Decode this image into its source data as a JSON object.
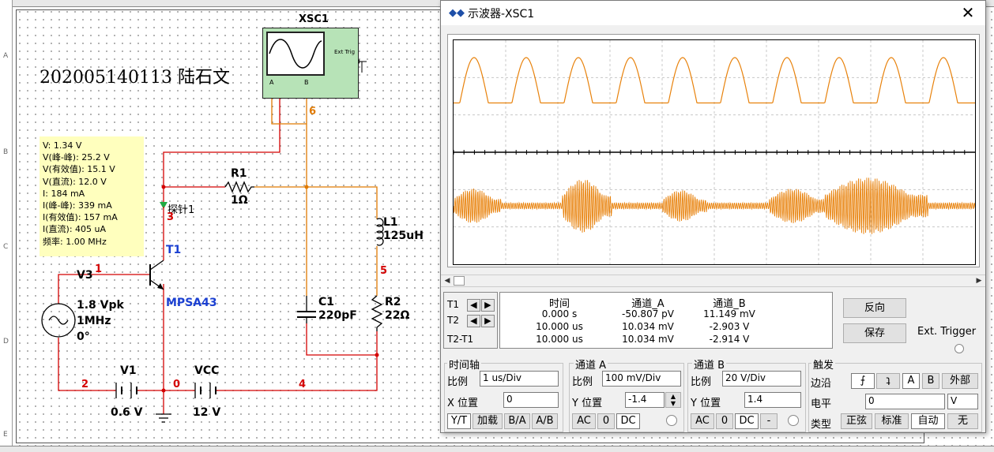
{
  "schematic": {
    "title": "202005140113 陆石文",
    "scope_label": "XSC1",
    "scope_ext_trig": "Ext Trig",
    "scope_ch_a": "A",
    "scope_ch_b": "B",
    "probe": {
      "lines": [
        "V: 1.34 V",
        "V(峰-峰): 25.2 V",
        "V(有效值): 15.1 V",
        "V(直流): 12.0 V",
        "I: 184 mA",
        "I(峰-峰): 339 mA",
        "I(有效值): 157 mA",
        "I(直流): 405 uA",
        "频率: 1.00 MHz"
      ],
      "name": "探针1"
    },
    "r1": {
      "name": "R1",
      "value": "1Ω"
    },
    "r2": {
      "name": "R2",
      "value": "22Ω"
    },
    "l1": {
      "name": "L1",
      "value": "125uH"
    },
    "c1": {
      "name": "C1",
      "value": "220pF"
    },
    "t1": {
      "name": "T1",
      "model": "MPSA43"
    },
    "v3": {
      "name": "V3",
      "amp": "1.8 Vpk",
      "freq": "1MHz",
      "phase": "0°"
    },
    "v1": {
      "name": "V1",
      "value": "0.6 V"
    },
    "vcc": {
      "name": "VCC",
      "value": "12 V"
    },
    "nets": {
      "n1": "1",
      "n2": "2",
      "n3": "3",
      "n4": "4",
      "n5": "5",
      "n6": "6",
      "n0": "0"
    },
    "rows": [
      "A",
      "B",
      "C",
      "D",
      "E"
    ],
    "colors": {
      "probe_bg": "#ffffbe",
      "wire_red": "#d40000",
      "wire_orange": "#e07a00",
      "label_blue": "#1a3fd1"
    }
  },
  "oscilloscope": {
    "title": "示波器-XSC1",
    "trace_color": "#e8820c",
    "readout": {
      "headers": [
        "时间",
        "通道_A",
        "通道_B"
      ],
      "rows": [
        {
          "label": "T1",
          "time": "0.000 s",
          "a": "-50.807 pV",
          "b": "11.149 mV"
        },
        {
          "label": "T2",
          "time": "10.000 us",
          "a": "10.034 mV",
          "b": "-2.903 V"
        },
        {
          "label": "T2-T1",
          "time": "10.000 us",
          "a": "10.034 mV",
          "b": "-2.914 V"
        }
      ]
    },
    "buttons": {
      "reverse": "反向",
      "save": "保存",
      "ext_trigger": "Ext. Trigger"
    },
    "timebase": {
      "group": "时间轴",
      "scale_label": "比例",
      "scale_value": "1 us/Div",
      "xpos_label": "X 位置",
      "xpos_value": "0",
      "modes": [
        "Y/T",
        "加载",
        "B/A",
        "A/B"
      ]
    },
    "channel_a": {
      "group": "通道 A",
      "scale_label": "比例",
      "scale_value": "100 mV/Div",
      "ypos_label": "Y 位置",
      "ypos_value": "-1.4",
      "coupling": [
        "AC",
        "0",
        "DC"
      ]
    },
    "channel_b": {
      "group": "通道 B",
      "scale_label": "比例",
      "scale_value": "20  V/Div",
      "ypos_label": "Y 位置",
      "ypos_value": "1.4",
      "coupling": [
        "AC",
        "0",
        "DC",
        "-"
      ]
    },
    "trigger": {
      "group": "触发",
      "edge_label": "边沿",
      "edge_buttons": [
        "⨍",
        "ʇ",
        "A",
        "B",
        "外部"
      ],
      "level_label": "电平",
      "level_value": "0",
      "level_unit": "V",
      "type_label": "类型",
      "types": [
        "正弦",
        "标准",
        "自动",
        "无"
      ]
    }
  }
}
